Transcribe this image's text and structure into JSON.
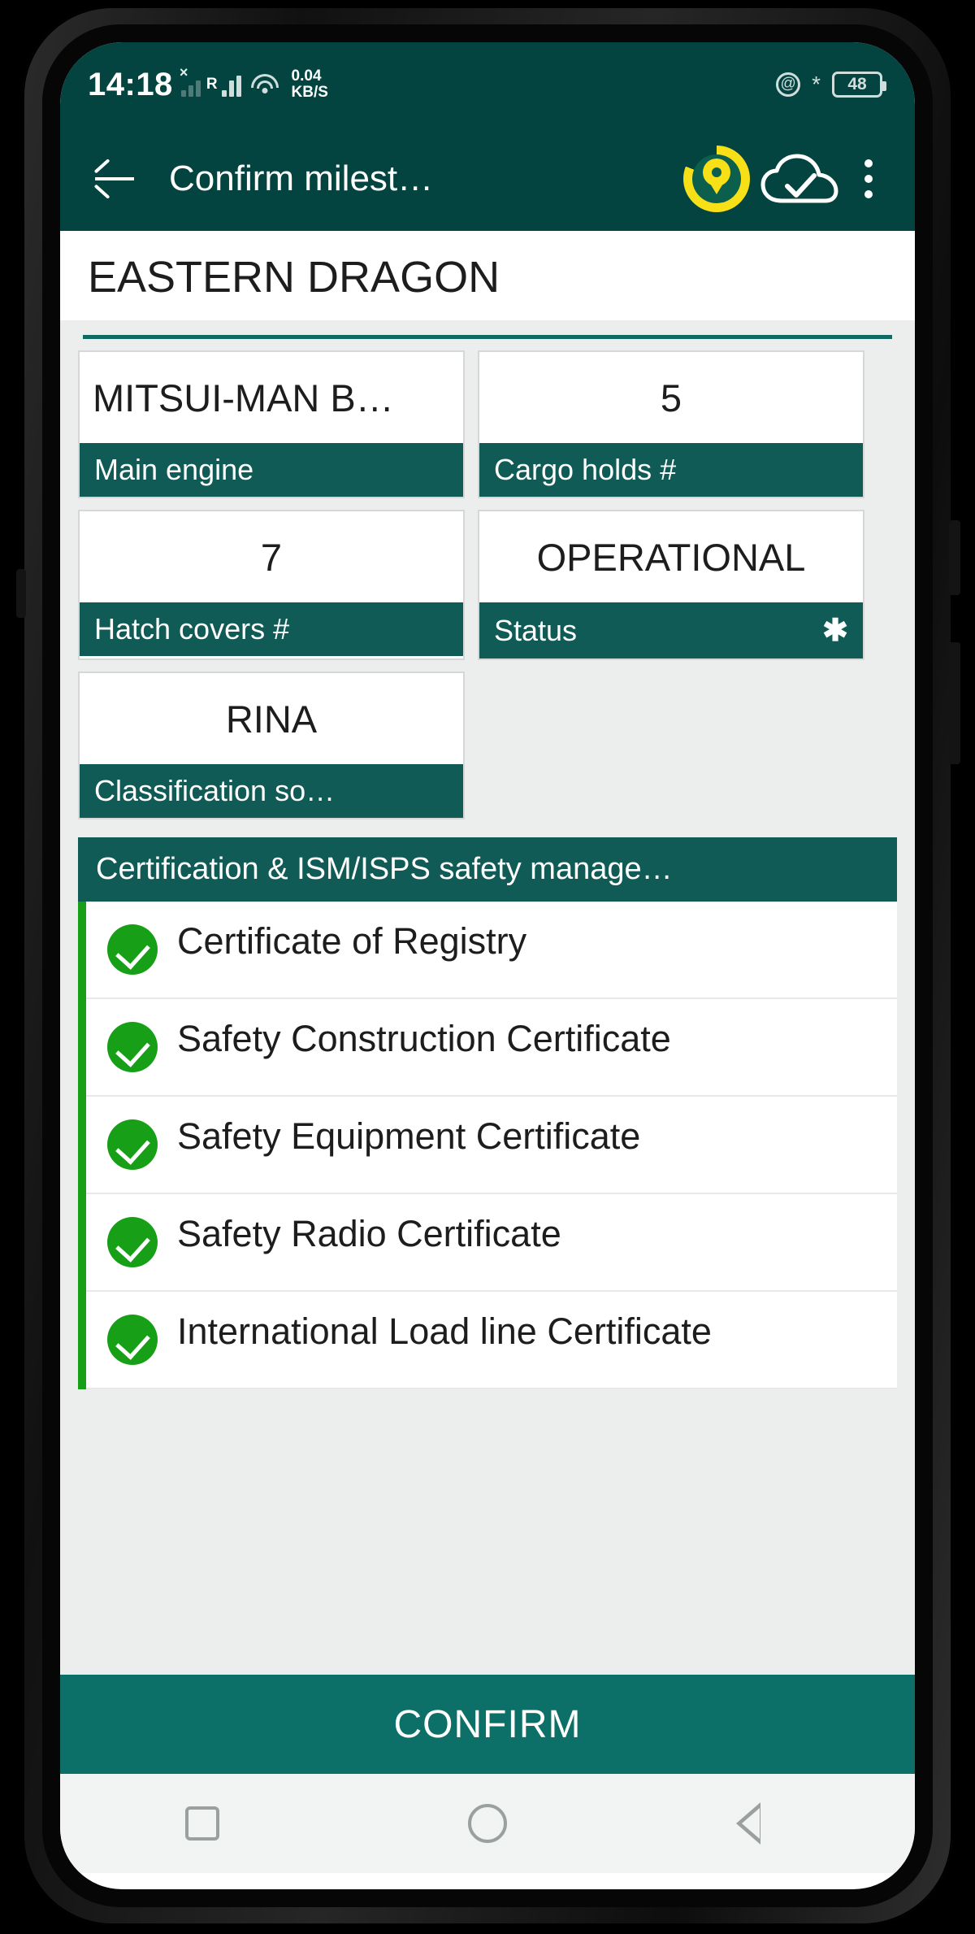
{
  "status_bar": {
    "time": "14:18",
    "network_speed": "0.04",
    "network_speed_unit": "KB/S",
    "roaming_label": "R",
    "no_sim_marker": "×",
    "battery_percent": "48",
    "icons": [
      "signal-bars-icon",
      "roaming-icon",
      "wifi-icon",
      "location-icon",
      "bluetooth-icon",
      "battery-icon"
    ]
  },
  "app_bar": {
    "back_label": "back-arrow",
    "title": "Confirm milest…",
    "actions": [
      "timer-progress-icon",
      "cloud-sync-icon",
      "overflow-menu-icon"
    ]
  },
  "colors": {
    "primary_dark": "#034440",
    "label_teal": "#115b57",
    "confirm_teal": "#0d7068",
    "accent_green": "#17a017",
    "timer_yellow": "#f7e017",
    "page_background": "#eceeed"
  },
  "vessel": {
    "name": "EASTERN DRAGON"
  },
  "fields": [
    {
      "value": "MITSUI-MAN B…",
      "label": "Main engine",
      "required": false,
      "align": "left"
    },
    {
      "value": "5",
      "label": "Cargo holds #",
      "required": false,
      "align": "center"
    },
    {
      "value": "7",
      "label": "Hatch covers #",
      "required": false,
      "align": "center"
    },
    {
      "value": "OPERATIONAL",
      "label": "Status",
      "required": true,
      "required_mark": "✱",
      "align": "center"
    },
    {
      "value": "RINA",
      "label": "Classification so…",
      "required": false,
      "align": "center"
    }
  ],
  "certification_section": {
    "header": "Certification & ISM/ISPS safety manage…",
    "items": [
      {
        "label": "Certificate of Registry",
        "checked": true
      },
      {
        "label": "Safety Construction Certificate",
        "checked": true
      },
      {
        "label": "Safety Equipment Certificate",
        "checked": true
      },
      {
        "label": "Safety Radio Certificate",
        "checked": true
      },
      {
        "label": "International Load line Certificate",
        "checked": true
      }
    ]
  },
  "confirm_button": {
    "label": "CONFIRM"
  },
  "nav_bar": {
    "items": [
      "recents-square-icon",
      "home-circle-icon",
      "back-triangle-icon"
    ]
  }
}
